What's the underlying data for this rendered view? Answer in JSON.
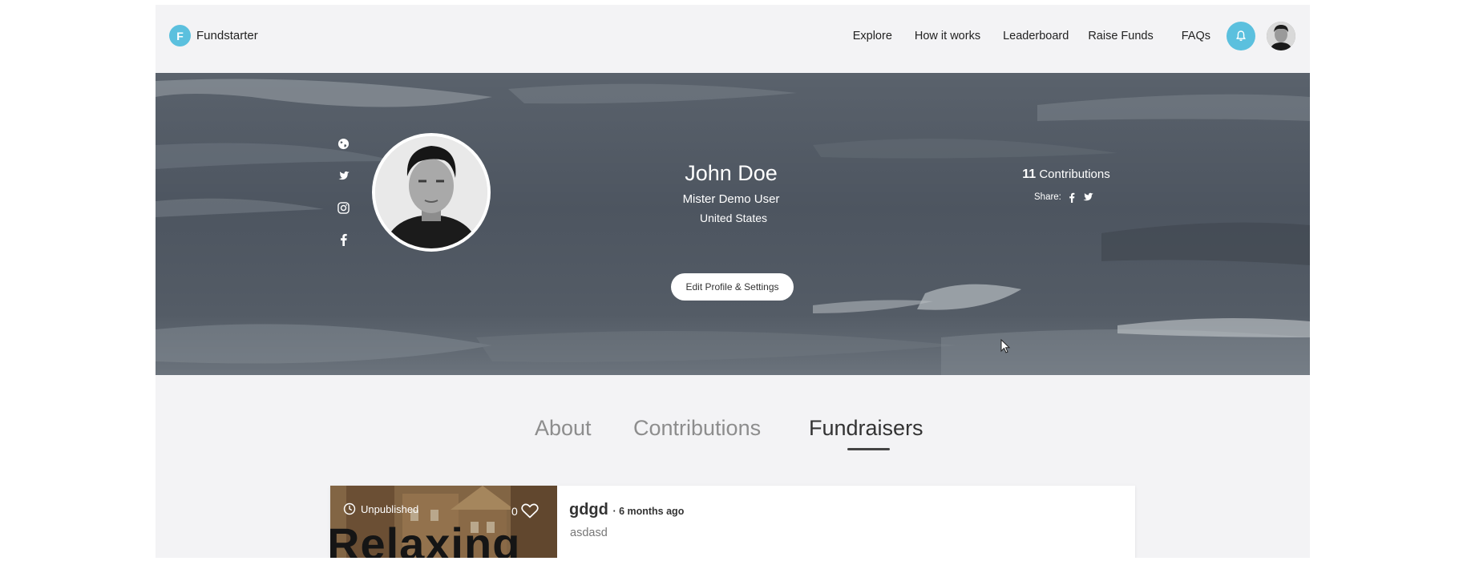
{
  "brand": {
    "logo_letter": "F",
    "name": "Fundstarter",
    "color": "#5bc0de"
  },
  "nav": {
    "links": [
      "Explore",
      "How it works",
      "Leaderboard",
      "Raise Funds",
      "FAQs"
    ],
    "notification_icon": "bell-icon",
    "avatar_icon": "user-avatar"
  },
  "profile": {
    "name": "John Doe",
    "title": "Mister Demo User",
    "location": "United States",
    "edit_button": "Edit Profile & Settings",
    "contributions_count": "11",
    "contributions_label": "Contributions",
    "share_label": "Share:",
    "social_icons": [
      "globe-icon",
      "twitter-icon",
      "instagram-icon",
      "facebook-icon"
    ],
    "share_icons": [
      "facebook-icon",
      "twitter-icon"
    ]
  },
  "tabs": {
    "about": "About",
    "contributions": "Contributions",
    "fundraisers": "Fundraisers",
    "active": "fundraisers"
  },
  "fundraiser_card": {
    "status": "Unpublished",
    "likes": "0",
    "thumbnail_text": "Relaxing",
    "title": "gdgd",
    "time": "· 6 months ago",
    "description": "asdasd"
  }
}
